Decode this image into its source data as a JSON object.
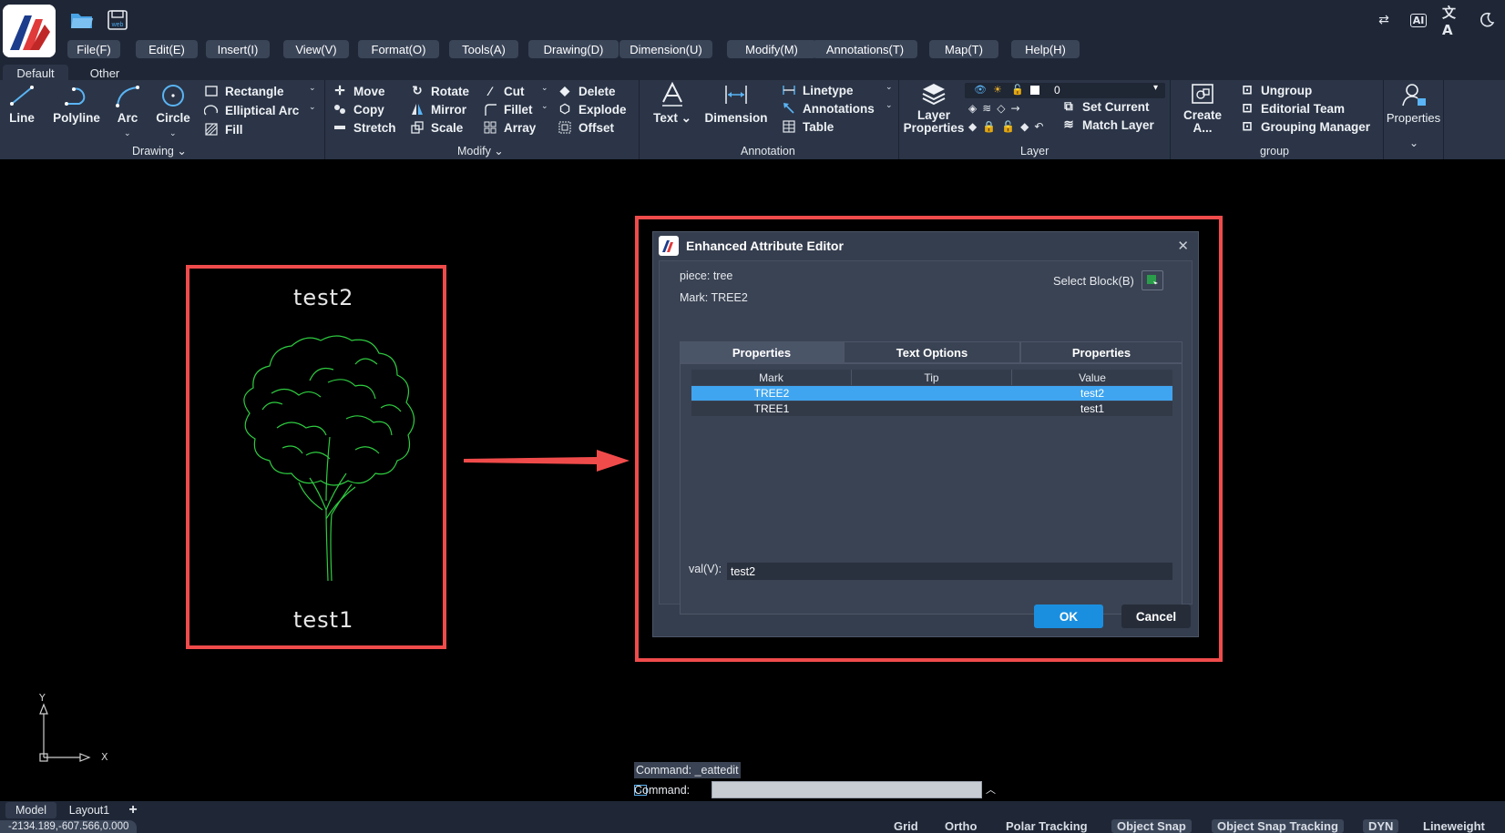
{
  "quick_access": {
    "open_icon": "folder-open-icon",
    "save_icon": "save-web-icon",
    "save_text": "web"
  },
  "menubar": [
    "File(F)",
    "Edit(E)",
    "Insert(I)",
    "View(V)",
    "Format(O)",
    "Tools(A)",
    "Drawing(D)",
    "Dimension(U)",
    "Modify(M)",
    "Annotations(T)",
    "Map(T)",
    "Help(H)"
  ],
  "top_right_icons": [
    "swap-icon",
    "ai-icon",
    "translate-icon",
    "dark-mode-icon"
  ],
  "ai_label": "AI",
  "translate_glyph": "文A",
  "ribbon_tabs": [
    "Default",
    "Other"
  ],
  "ribbon": {
    "drawing": {
      "label": "Drawing",
      "big": [
        "Line",
        "Polyline",
        "Arc",
        "Circle"
      ],
      "small": [
        "Rectangle",
        "Elliptical Arc",
        "Fill"
      ]
    },
    "modify": {
      "label": "Modify",
      "col1": [
        "Move",
        "Copy",
        "Stretch"
      ],
      "col2": [
        "Rotate",
        "Mirror",
        "Scale"
      ],
      "col3": [
        "Cut",
        "Fillet",
        "Array"
      ],
      "col4": [
        "Delete",
        "Explode",
        "Offset"
      ]
    },
    "annotation": {
      "label": "Annotation",
      "big": [
        "Text",
        "Dimension"
      ],
      "small": [
        "Linetype",
        "Annotations",
        "Table"
      ]
    },
    "layer": {
      "label": "Layer",
      "big_line1": "Layer",
      "big_line2": "Properties",
      "layer_value": "0",
      "small": [
        "Set Current",
        "Match Layer"
      ]
    },
    "group": {
      "label": "group",
      "big_line1": "Create",
      "big_line2": "A...",
      "small": [
        "Ungroup",
        "Editorial Team",
        "Grouping Manager"
      ]
    },
    "properties": {
      "label": "Properties"
    }
  },
  "canvas": {
    "top_attr_text": "test2",
    "bottom_attr_text": "test1",
    "axis_y": "Y",
    "axis_x": "X"
  },
  "dialog": {
    "title": "Enhanced Attribute Editor",
    "piece": "piece: tree",
    "mark": "Mark: TREE2",
    "select_block": "Select Block(B)",
    "tabs": [
      "Properties",
      "Text Options",
      "Properties"
    ],
    "columns": [
      "Mark",
      "Tip",
      "Value"
    ],
    "rows": [
      {
        "mark": "TREE2",
        "tip": "",
        "value": "test2",
        "selected": true
      },
      {
        "mark": "TREE1",
        "tip": "",
        "value": "test1",
        "selected": false
      }
    ],
    "val_label": "val(V):",
    "val_value": "test2",
    "ok": "OK",
    "cancel": "Cancel"
  },
  "command": {
    "history": "Command: _eattedit",
    "prompt": "Command:",
    "input": ""
  },
  "layout_tabs": [
    "Model",
    "Layout1"
  ],
  "add_layout": "+",
  "coords": "-2134.189,-607.566,0.000",
  "status_toggles": [
    {
      "label": "Grid",
      "on": false
    },
    {
      "label": "Ortho",
      "on": false
    },
    {
      "label": "Polar Tracking",
      "on": false
    },
    {
      "label": "Object Snap",
      "on": true
    },
    {
      "label": "Object Snap Tracking",
      "on": true
    },
    {
      "label": "DYN",
      "on": true
    },
    {
      "label": "Lineweight",
      "on": false
    }
  ],
  "colors": {
    "accent": "#3fa5f0",
    "highlight_red": "#f04b4b",
    "cad_green": "#2ecc40",
    "menu_bg": "#3a4558",
    "ok_button": "#1a8fe0"
  }
}
